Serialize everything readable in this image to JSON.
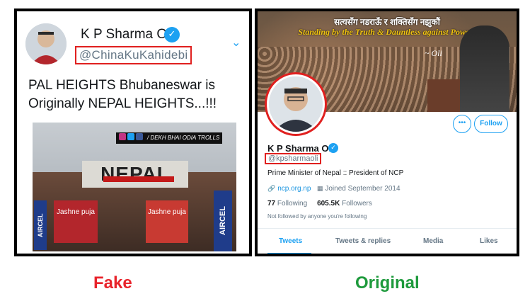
{
  "fake": {
    "profile": {
      "name": "K P Sharma Oli",
      "handle": "@ChinaKuKahidebi",
      "verified_icon": "verified-badge-icon",
      "chevron_icon": "chevron-down-icon"
    },
    "tweet_text": "PAL HEIGHTS Bhubaneswar is Originally NEPAL HEIGHTS...!!!",
    "photo": {
      "credit": "/ DEKH BHAI ODIA TROLLS",
      "sign_text": "NEPAL",
      "shop_left": "Jashne puja",
      "shop_right": "Jashne puja",
      "side_sign_left": "AIRCEL",
      "side_sign_right": "AIRCEL"
    }
  },
  "original": {
    "banner": {
      "headline": "सत्यसँग नडराऊँ र शक्तिसँग नझुकौं",
      "tagline": "Standing by the Truth & Dauntless against Power!"
    },
    "buttons": {
      "more": "•••",
      "follow": "Follow"
    },
    "profile": {
      "name": "K P Sharma Oli",
      "handle": "@kpsharmaoli",
      "bio": "Prime Minister of Nepal :: President of NCP",
      "website": "ncp.org.np",
      "joined": "Joined September 2014",
      "following_count": "77",
      "following_label": "Following",
      "followers_count": "605.5K",
      "followers_label": "Followers",
      "not_followed": "Not followed by anyone you're following"
    },
    "tabs": [
      "Tweets",
      "Tweets & replies",
      "Media",
      "Likes"
    ]
  },
  "captions": {
    "fake": "Fake",
    "original": "Original"
  },
  "colors": {
    "fake_caption": "#e8232b",
    "original_caption": "#1e9a3c",
    "twitter_blue": "#1da1f2",
    "highlight_box": "#e0201f"
  }
}
